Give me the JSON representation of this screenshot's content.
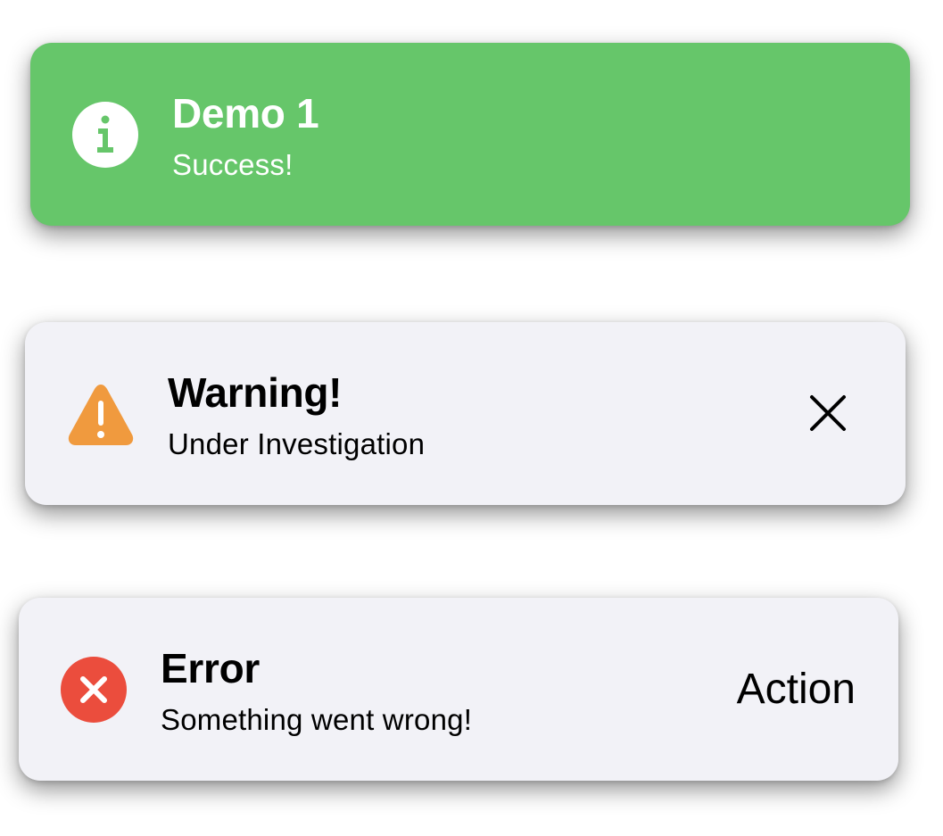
{
  "toasts": {
    "success": {
      "title": "Demo 1",
      "subtitle": "Success!",
      "icon": "info-icon",
      "background": "#66c66a"
    },
    "warning": {
      "title": "Warning!",
      "subtitle": "Under Investigation",
      "icon": "warning-icon",
      "icon_color": "#f09a3e",
      "dismiss_icon": "close-icon",
      "background": "#f2f2f7"
    },
    "error": {
      "title": "Error",
      "subtitle": "Something went wrong!",
      "icon": "error-icon",
      "icon_color": "#eb4d3d",
      "action_label": "Action",
      "background": "#f2f2f7"
    }
  }
}
